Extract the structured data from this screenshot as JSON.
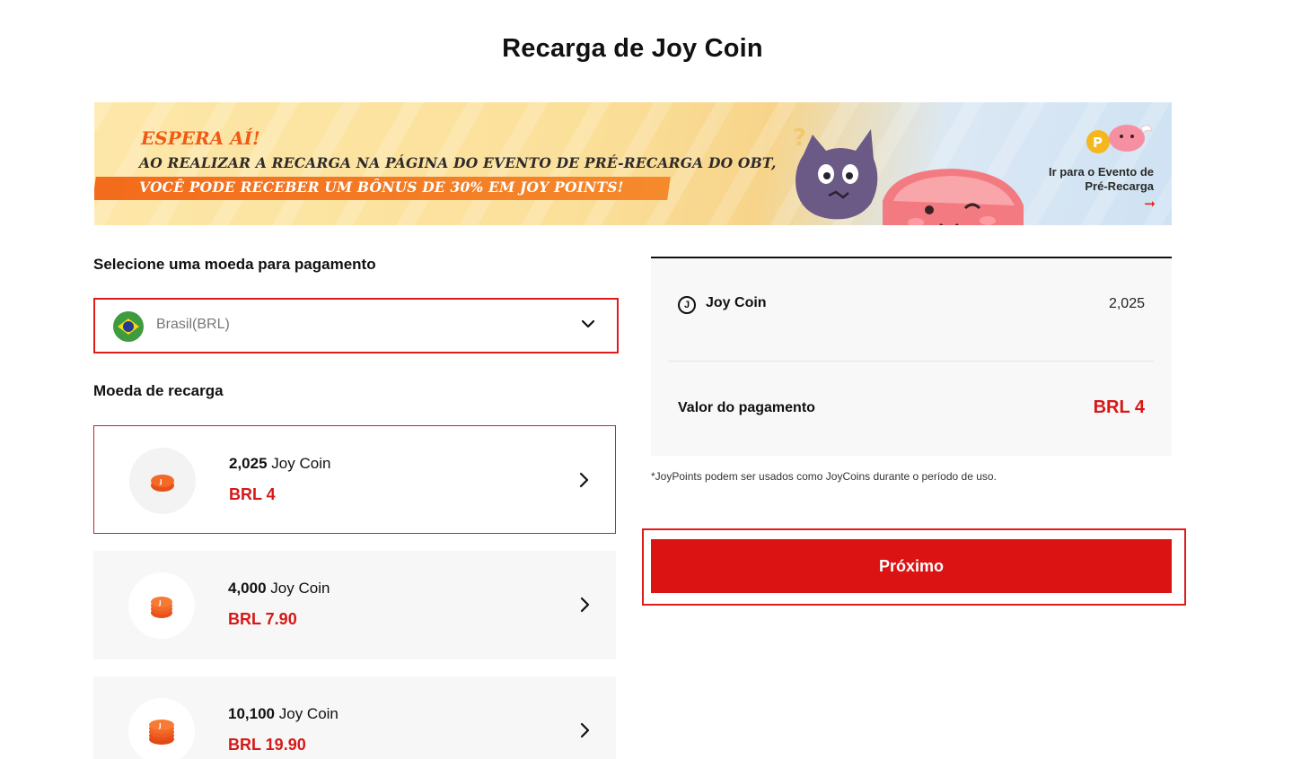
{
  "page": {
    "title": "Recarga de Joy Coin"
  },
  "banner": {
    "line1": "ESPERA AÍ!",
    "line2": "AO REALIZAR A RECARGA NA PÁGINA DO EVENTO DE PRÉ-RECARGA DO OBT,",
    "line3": "VOCÊ PODE RECEBER UM BÔNUS DE 30% EM JOY POINTS!",
    "cta_line1": "Ir para o Evento de",
    "cta_line2": "Pré-Recarga",
    "cta_arrow": "➞"
  },
  "currency": {
    "label": "Selecione uma moeda para pagamento",
    "selected": "Brasil(BRL)",
    "flag_icon": "brazil-flag-icon"
  },
  "packages": {
    "label": "Moeda de recarga",
    "items": [
      {
        "amount": "2,025",
        "unit": "Joy Coin",
        "price": "BRL 4",
        "selected": true
      },
      {
        "amount": "4,000",
        "unit": "Joy Coin",
        "price": "BRL 7.90",
        "selected": false
      },
      {
        "amount": "10,100",
        "unit": "Joy Coin",
        "price": "BRL 19.90",
        "selected": false
      }
    ]
  },
  "summary": {
    "coin_icon": "J",
    "coin_label": "Joy Coin",
    "coin_value": "2,025",
    "payment_label": "Valor do pagamento",
    "payment_value": "BRL 4"
  },
  "footnote": "*JoyPoints podem ser usados como JoyCoins durante o período de uso.",
  "next_button": "Próximo",
  "colors": {
    "accent": "#db1313",
    "price": "#d61818",
    "banner_orange": "#f05a14"
  }
}
